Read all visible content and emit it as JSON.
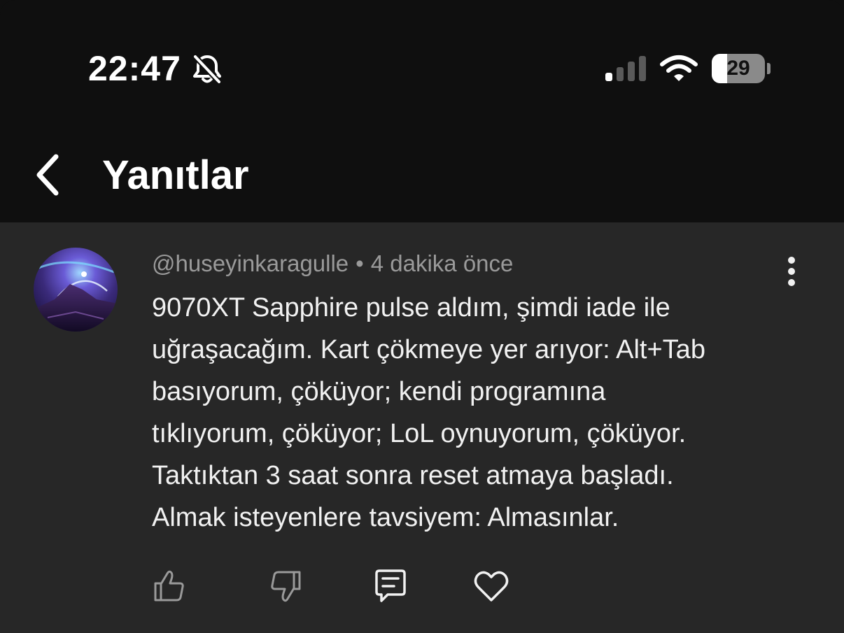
{
  "status_bar": {
    "time": "22:47",
    "battery_level": "29",
    "battery_fraction": 0.29,
    "icons": [
      "bell-slash-icon",
      "cellular-signal-icon",
      "wifi-icon",
      "battery-icon"
    ]
  },
  "header": {
    "back_icon": "chevron-left-icon",
    "title": "Yanıtlar"
  },
  "comment": {
    "author": "@huseyinkaragulle",
    "separator": "•",
    "timestamp": "4 dakika önce",
    "text_lines": [
      "9070XT Sapphire pulse aldım, şimdi iade ile",
      "uğraşacağım. Kart çökmeye yer arıyor: Alt+Tab",
      "basıyorum, çöküyor; kendi programına",
      "tıklıyorum, çöküyor; LoL oynuyorum, çöküyor.",
      "Taktıktan 3 saat sonra reset atmaya başladı.",
      "Almak isteyenlere tavsiyem: Almasınlar."
    ],
    "more_icon": "more-vertical-icon",
    "actions": [
      "thumbs-up-icon",
      "thumbs-down-icon",
      "reply-icon",
      "heart-icon"
    ]
  },
  "colors": {
    "background": "#0f0f0f",
    "panel": "#272727",
    "text": "#f1f1f1",
    "meta_text": "#9a9a9a"
  }
}
